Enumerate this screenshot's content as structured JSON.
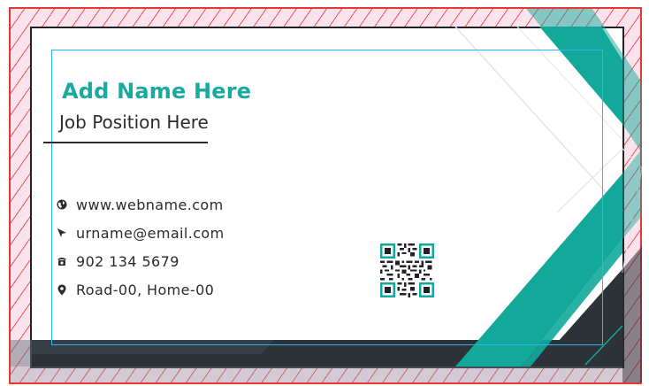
{
  "card": {
    "name": "Add Name Here",
    "job_title": "Job Position Here",
    "contacts": [
      {
        "icon": "globe-icon",
        "text": "www.webname.com"
      },
      {
        "icon": "send-icon",
        "text": "urname@email.com"
      },
      {
        "icon": "phone-icon",
        "text": "902 134 5679"
      },
      {
        "icon": "location-pin-icon",
        "text": "Road-00, Home-00"
      }
    ]
  },
  "colors": {
    "accent": "#1aa99e",
    "dark": "#2c3238",
    "bleed_fill": "#fbe3ee",
    "bleed_hatch": "#e53935",
    "safe_line": "#29b6f6"
  }
}
